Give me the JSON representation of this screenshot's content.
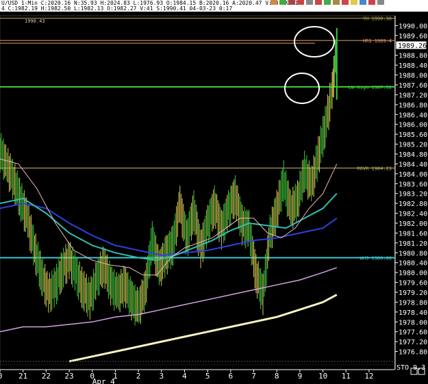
{
  "header": {
    "line1": "U/USD 1-Min C:2020.16 N:35.93 H:2024.83 L:1976.93 O:1984.15 B:2020.16 A:2020.47 V:53.6K OI:",
    "line2": "4 C:1982.19 H:1982.50 L:1982.13 O:1982.27 V:41 S:1990.41 04-03-23 0:17"
  },
  "colors": {
    "background": "#000000",
    "text": "#ffffff",
    "yh_line": "#b8a84a",
    "hr1_line": "#e8a060",
    "lw_high_line": "#3cd23c",
    "rovr_line": "#c8b464",
    "wh3_line": "#3cc8d0",
    "price_up": "#3cc83c",
    "price_down": "#d8c850",
    "ema_pink": "#f0b8b8",
    "ema_teal": "#30c0b0",
    "ema_blue": "#3040e0",
    "ma_violet": "#d8a0e8",
    "ma_cream": "#f8f4c0",
    "circle": "#ffffff"
  },
  "icons": [
    "toolbar-icons"
  ],
  "chart_data": {
    "type": "line",
    "symbol_fragment": "U/USD 1-Min",
    "y_ticks": [
      "1990.00",
      "1989.60",
      "1988.80",
      "1988.40",
      "1988.00",
      "1987.60",
      "1987.20",
      "1986.80",
      "1986.40",
      "1986.00",
      "1985.60",
      "1985.20",
      "1984.80",
      "1984.40",
      "1984.00",
      "1983.60",
      "1983.20",
      "1982.80",
      "1982.40",
      "1982.00",
      "1981.60",
      "1981.20",
      "1980.80",
      "1980.40",
      "1980.00",
      "1979.60",
      "1979.20",
      "1978.80",
      "1978.40",
      "1978.00",
      "1977.60",
      "1977.20",
      "1976.80"
    ],
    "y_tick_values": [
      1990.0,
      1989.6,
      1988.8,
      1988.4,
      1988.0,
      1987.6,
      1987.2,
      1986.8,
      1986.4,
      1986.0,
      1985.6,
      1985.2,
      1984.8,
      1984.4,
      1984.0,
      1983.6,
      1983.2,
      1982.8,
      1982.4,
      1982.0,
      1981.6,
      1981.2,
      1980.8,
      1980.4,
      1980.0,
      1979.6,
      1979.2,
      1978.8,
      1978.4,
      1978.0,
      1977.6,
      1977.2,
      1976.8
    ],
    "ylim": [
      1976.4,
      1990.4
    ],
    "current_price": "1989.26",
    "current_price_value": 1989.26,
    "x_ticks": [
      "0",
      "21",
      "22",
      "23",
      "0",
      "1",
      "2",
      "3",
      "4",
      "5",
      "6",
      "7",
      "8",
      "9",
      "10",
      "11",
      "12"
    ],
    "x_tick_hours": [
      20,
      21,
      22,
      23,
      24,
      25,
      26,
      27,
      28,
      29,
      30,
      31,
      32,
      33,
      34,
      35,
      36
    ],
    "date_label": "Apr 4",
    "date_label_hour": 24,
    "xlim": [
      20,
      37.1
    ],
    "top_left_label": "1990.43",
    "levels": [
      {
        "label": "YH 1990.30",
        "value": 1990.3,
        "color_key": "yh_line"
      },
      {
        "label": "HR1 1989.4",
        "value": 1989.4,
        "color_key": "hr1_line"
      },
      {
        "label": "LW High 1987.52",
        "value": 1987.52,
        "color_key": "lw_high_line"
      },
      {
        "label": "ROVR 1984.23",
        "value": 1984.23,
        "color_key": "rovr_line"
      },
      {
        "label": "WH3 1980.60",
        "value": 1980.6,
        "color_key": "wh3_line"
      }
    ],
    "price": {
      "x": [
        20.0,
        20.3,
        20.6,
        20.9,
        21.2,
        21.5,
        21.8,
        22.1,
        22.4,
        22.7,
        23.0,
        23.3,
        23.6,
        23.9,
        24.2,
        24.5,
        24.8,
        25.1,
        25.4,
        25.7,
        26.0,
        26.3,
        26.6,
        26.9,
        27.2,
        27.5,
        27.8,
        28.1,
        28.4,
        28.7,
        29.0,
        29.3,
        29.6,
        29.9,
        30.2,
        30.5,
        30.8,
        31.1,
        31.4,
        31.7,
        32.0,
        32.3,
        32.6,
        32.9,
        33.2,
        33.5,
        33.8,
        34.1,
        34.4,
        34.6
      ],
      "y": [
        1985.0,
        1984.4,
        1983.8,
        1983.0,
        1982.2,
        1981.0,
        1980.0,
        1979.2,
        1979.5,
        1980.2,
        1980.6,
        1980.0,
        1979.4,
        1979.0,
        1979.8,
        1980.4,
        1979.6,
        1979.2,
        1979.6,
        1979.0,
        1978.6,
        1979.4,
        1981.4,
        1980.2,
        1980.8,
        1981.2,
        1982.8,
        1981.4,
        1982.6,
        1981.0,
        1982.0,
        1982.8,
        1981.8,
        1982.6,
        1983.2,
        1982.0,
        1981.8,
        1980.0,
        1979.2,
        1981.6,
        1982.6,
        1983.8,
        1982.6,
        1983.0,
        1984.2,
        1983.6,
        1984.8,
        1986.0,
        1987.4,
        1989.26
      ]
    },
    "ema_fast": {
      "x": [
        20.0,
        20.8,
        21.6,
        22.4,
        23.2,
        24.0,
        24.8,
        25.6,
        26.2,
        26.8,
        27.4,
        28.0,
        28.6,
        29.2,
        29.8,
        30.4,
        31.0,
        31.6,
        32.2,
        32.8,
        33.4,
        34.0,
        34.6
      ],
      "y": [
        1984.6,
        1984.4,
        1983.4,
        1982.0,
        1980.9,
        1980.5,
        1980.3,
        1980.2,
        1979.9,
        1979.9,
        1980.6,
        1981.0,
        1981.2,
        1981.4,
        1981.8,
        1982.2,
        1982.2,
        1981.6,
        1981.4,
        1981.8,
        1982.6,
        1983.2,
        1984.4
      ]
    },
    "ema_mid": {
      "x": [
        20.0,
        21.0,
        22.0,
        23.0,
        24.0,
        25.0,
        26.0,
        26.8,
        27.6,
        28.4,
        29.2,
        30.0,
        30.8,
        31.6,
        32.4,
        33.2,
        34.0,
        34.6
      ],
      "y": [
        1982.8,
        1983.0,
        1982.4,
        1981.6,
        1981.1,
        1980.8,
        1980.6,
        1980.5,
        1980.7,
        1981.0,
        1981.3,
        1981.7,
        1982.0,
        1981.9,
        1981.8,
        1982.2,
        1982.6,
        1983.2
      ]
    },
    "ema_slow": {
      "x": [
        20.0,
        21.0,
        22.0,
        23.0,
        24.0,
        25.0,
        26.0,
        27.0,
        28.0,
        29.0,
        30.0,
        31.0,
        32.0,
        33.0,
        34.0,
        34.6
      ],
      "y": [
        1982.6,
        1982.8,
        1982.6,
        1982.0,
        1981.5,
        1981.1,
        1980.9,
        1980.7,
        1980.8,
        1980.9,
        1981.1,
        1981.3,
        1981.4,
        1981.6,
        1981.8,
        1982.2
      ]
    },
    "ma_violet": {
      "x": [
        20.0,
        21.0,
        22.0,
        23.0,
        24.0,
        25.0,
        26.0,
        27.0,
        28.0,
        29.0,
        30.0,
        31.0,
        32.0,
        33.0,
        34.0,
        34.6
      ],
      "y": [
        1977.6,
        1977.8,
        1977.8,
        1977.9,
        1978.0,
        1978.2,
        1978.3,
        1978.5,
        1978.7,
        1978.9,
        1979.1,
        1979.3,
        1979.5,
        1979.7,
        1980.0,
        1980.2
      ]
    },
    "ma_cream": {
      "x": [
        23.0,
        24.0,
        25.0,
        26.0,
        27.0,
        28.0,
        29.0,
        30.0,
        31.0,
        32.0,
        33.0,
        34.0,
        34.6
      ],
      "y": [
        1976.4,
        1976.6,
        1976.8,
        1977.0,
        1977.2,
        1977.4,
        1977.6,
        1977.8,
        1978.0,
        1978.2,
        1978.5,
        1978.8,
        1979.1
      ]
    },
    "bottom_label": "STO 9.3"
  }
}
